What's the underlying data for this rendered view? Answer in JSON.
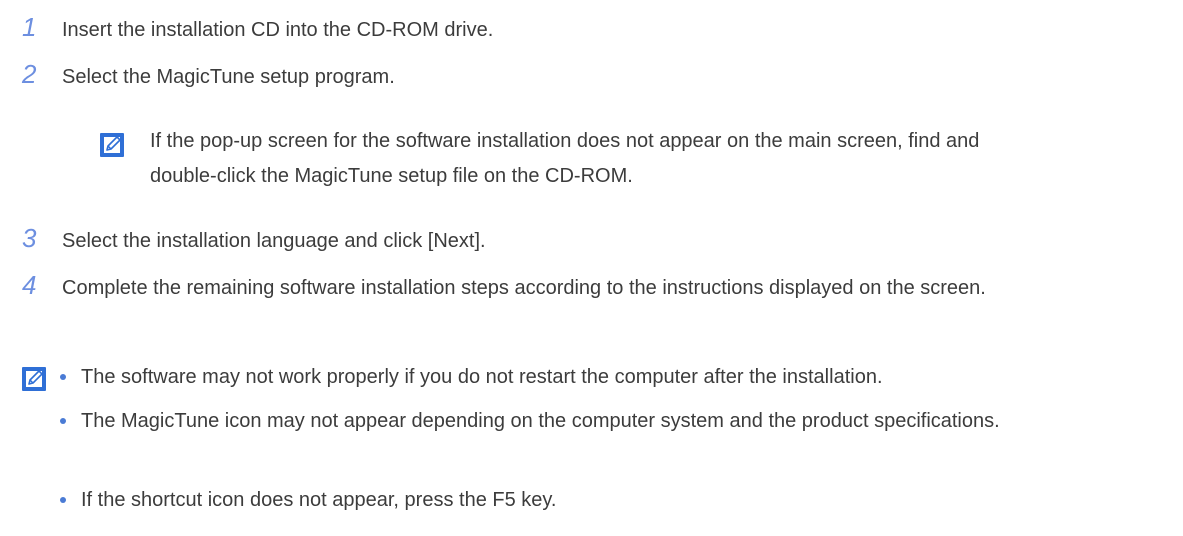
{
  "steps": [
    {
      "number": "1",
      "text": "Insert the installation CD into the CD-ROM drive."
    },
    {
      "number": "2",
      "text": "Select the MagicTune setup program."
    },
    {
      "number": "3",
      "text": "Select the installation language and click [Next]."
    },
    {
      "number": "4",
      "text": "Complete the remaining software installation steps according to the instructions displayed on the screen."
    }
  ],
  "step2_note": {
    "icon": "note-pencil-icon",
    "line1": "If the pop-up screen for the software installation does not appear on the main screen, find and",
    "line2": "double-click the MagicTune setup file on the CD-ROM."
  },
  "final_note": {
    "icon": "note-pencil-icon",
    "bullets": [
      "The software may not work properly if you do not restart the computer after the installation.",
      "The MagicTune icon may not appear depending on the computer system and the product specifications.",
      "If the shortcut icon does not appear, press the F5 key."
    ]
  },
  "colors": {
    "step_number": "#6d8fe0",
    "icon_blue": "#2f6fd6",
    "bullet": "#4a7bd5",
    "text": "#3c3c3c"
  }
}
